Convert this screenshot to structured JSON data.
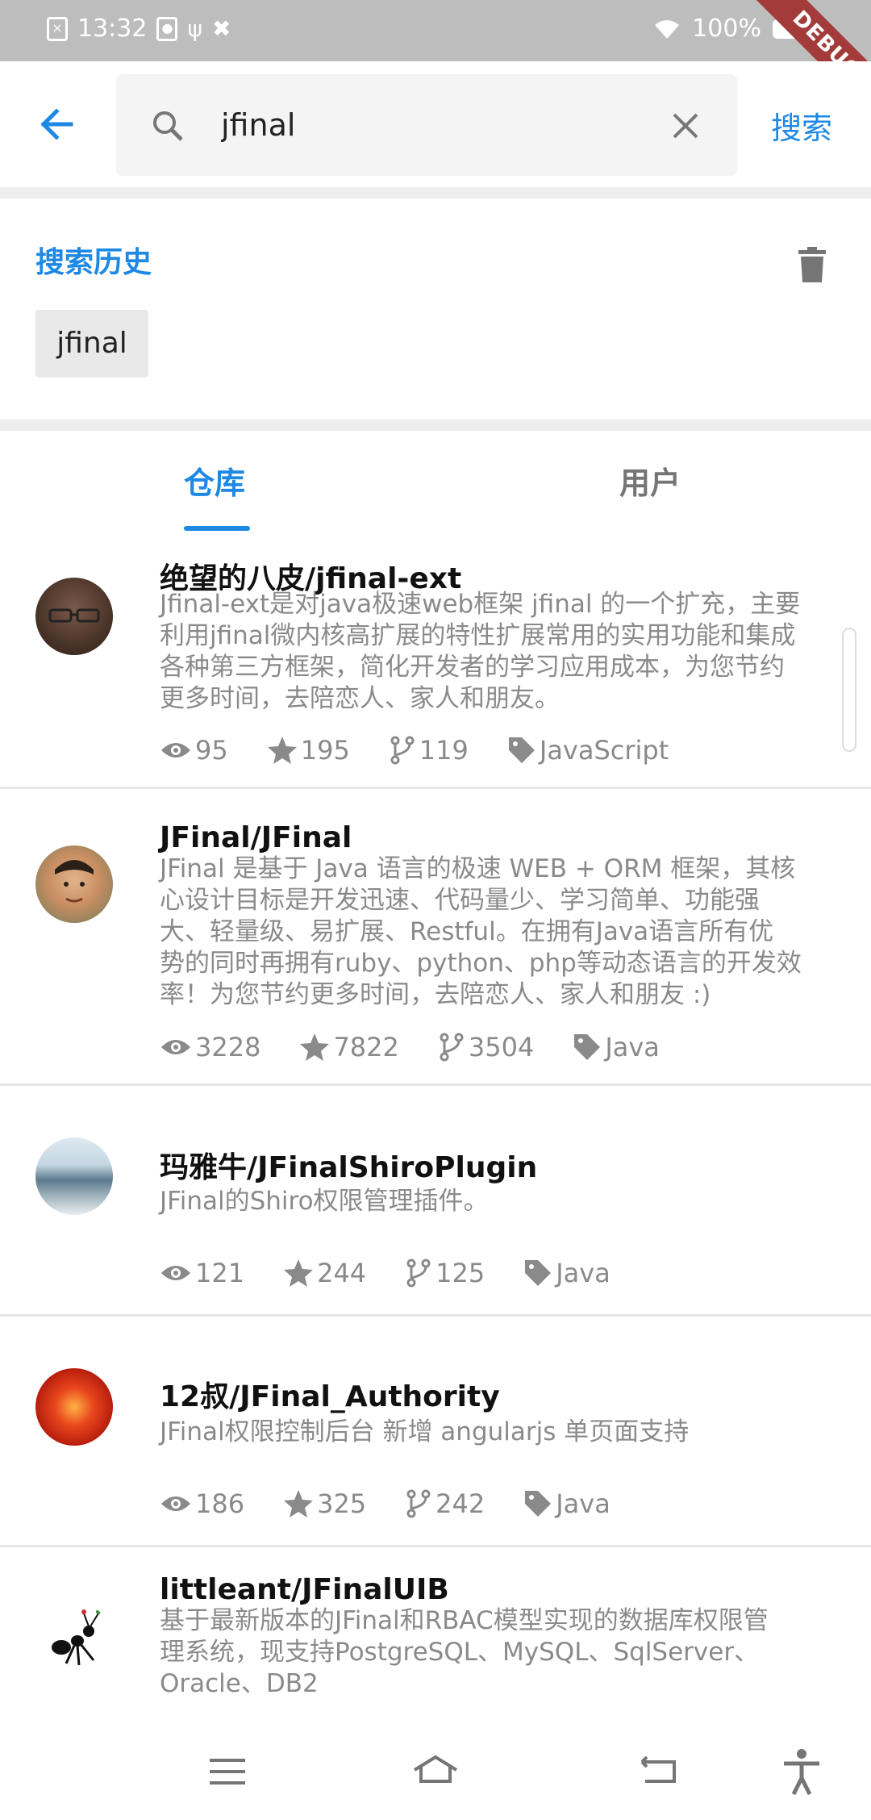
{
  "status_bar": {
    "time": "13:32",
    "battery": "100%"
  },
  "debug_banner": "DEBUG",
  "app_bar": {
    "query": "jfinal",
    "search_label": "搜索"
  },
  "history": {
    "title": "搜索历史",
    "items": [
      "jfinal"
    ]
  },
  "tabs": [
    "仓库",
    "用户"
  ],
  "repos": [
    {
      "name": "绝望的八皮/jfinal-ext",
      "desc_lines": [
        "Jfinal-ext是对java极速web框架 jfinal 的一个扩充，主要",
        "利用jfinal微内核高扩展的特性扩展常用的实用功能和集成",
        "各种第三方框架，简化开发者的学习应用成本，为您节约",
        "更多时间，去陪恋人、家人和朋友。"
      ],
      "watchers": "95",
      "stars": "195",
      "forks": "119",
      "language": "JavaScript"
    },
    {
      "name": "JFinal/JFinal",
      "desc_lines": [
        "JFinal 是基于 Java 语言的极速 WEB + ORM 框架，其核",
        "心设计目标是开发迅速、代码量少、学习简单、功能强",
        "大、轻量级、易扩展、Restful。在拥有Java语言所有优",
        "势的同时再拥有ruby、python、php等动态语言的开发效",
        "率！为您节约更多时间，去陪恋人、家人和朋友 :)"
      ],
      "watchers": "3228",
      "stars": "7822",
      "forks": "3504",
      "language": "Java"
    },
    {
      "name": "玛雅牛/JFinalShiroPlugin",
      "desc_lines": [
        "JFinal的Shiro权限管理插件。"
      ],
      "watchers": "121",
      "stars": "244",
      "forks": "125",
      "language": "Java"
    },
    {
      "name": "12叔/JFinal_Authority",
      "desc_lines": [
        "JFinal权限控制后台  新增 angularjs 单页面支持"
      ],
      "watchers": "186",
      "stars": "325",
      "forks": "242",
      "language": "Java"
    },
    {
      "name": "littleant/JFinalUIB",
      "desc_lines": [
        "基于最新版本的JFinal和RBAC模型实现的数据库权限管",
        "理系统，现支持PostgreSQL、MySQL、SqlServer、",
        "Oracle、DB2"
      ]
    }
  ],
  "colors": {
    "accent": "#1e88e5",
    "status_bar": "#bdbdbd",
    "debug": "#a33b3b",
    "muted_text": "#8a8a8a"
  },
  "icons": [
    "back-arrow-icon",
    "search-icon",
    "clear-icon",
    "trash-icon",
    "eye-icon",
    "star-icon",
    "fork-icon",
    "tag-icon",
    "menu-icon",
    "home-icon",
    "back-icon",
    "accessibility-icon"
  ]
}
